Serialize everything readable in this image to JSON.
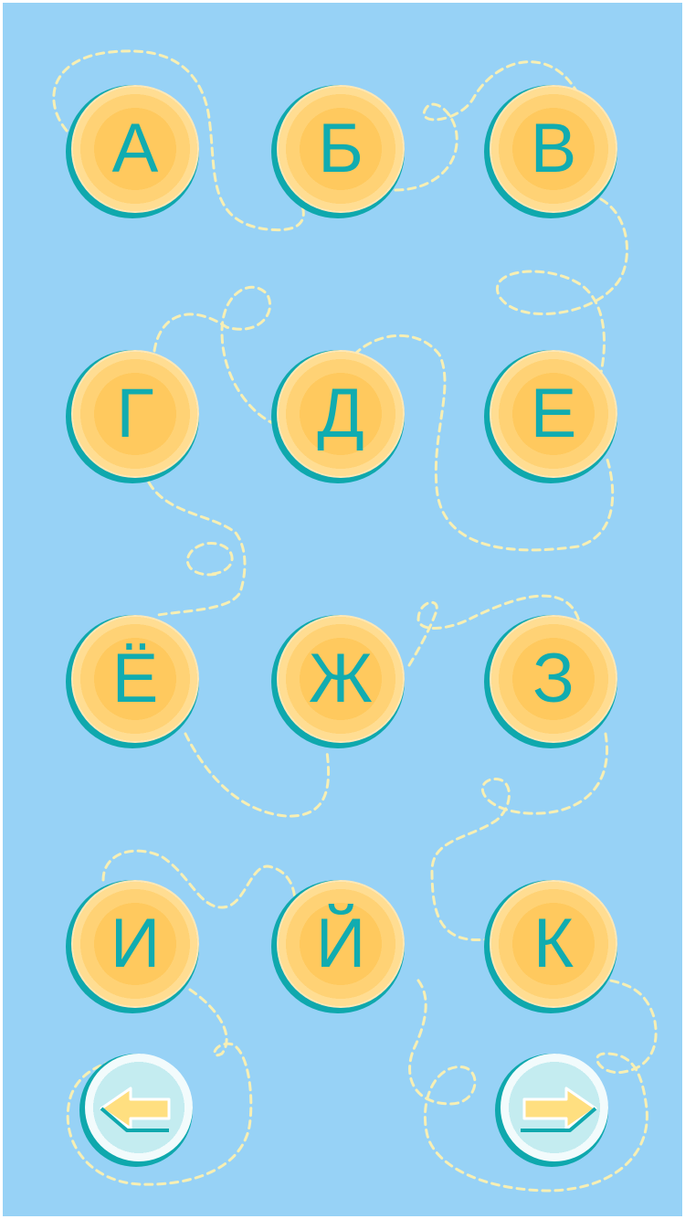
{
  "colors": {
    "background": "#97d2f6",
    "trail": "#f7efb4",
    "button_shadow": "#0fa8ad",
    "letter": "#11acb0",
    "arrow_fill": "#ffdf80"
  },
  "letters": [
    "А",
    "Б",
    "В",
    "Г",
    "Д",
    "Е",
    "Ё",
    "Ж",
    "З",
    "И",
    "Й",
    "К"
  ],
  "navigation": {
    "prev_icon": "arrow-left-icon",
    "next_icon": "arrow-right-icon"
  }
}
